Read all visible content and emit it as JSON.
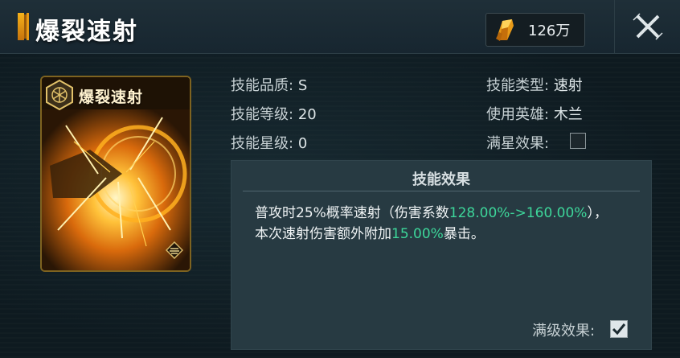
{
  "window": {
    "title": "爆裂速射",
    "currency_amount": "126万",
    "currency_icon": "gold-crystal-icon",
    "close_icon": "close-x-icon"
  },
  "card": {
    "title": "爆裂速射",
    "badge_icon": "skill-rank-badge-icon",
    "corner_icon": "stack-level-icon"
  },
  "attributes": {
    "quality_label": "技能品质:",
    "quality_value": "S",
    "level_label": "技能等级:",
    "level_value": "20",
    "star_label": "技能星级:",
    "star_value": "0",
    "type_label": "技能类型:",
    "type_value": "速射",
    "hero_label": "使用英雄:",
    "hero_value": "木兰",
    "fullstar_label": "满星效果:",
    "fullstar_checked": false
  },
  "effect": {
    "title": "技能效果",
    "line1_a": "普攻时25%概率速射（伤害系数",
    "line1_hl": "128.00%->160.00%",
    "line1_b": "），",
    "line2_a": "本次速射伤害额外附加",
    "line2_hl": "15.00%",
    "line2_b": "暴击。",
    "highlight_color": "#3dd69a",
    "maxlevel_label": "满级效果:",
    "maxlevel_checked": true
  }
}
